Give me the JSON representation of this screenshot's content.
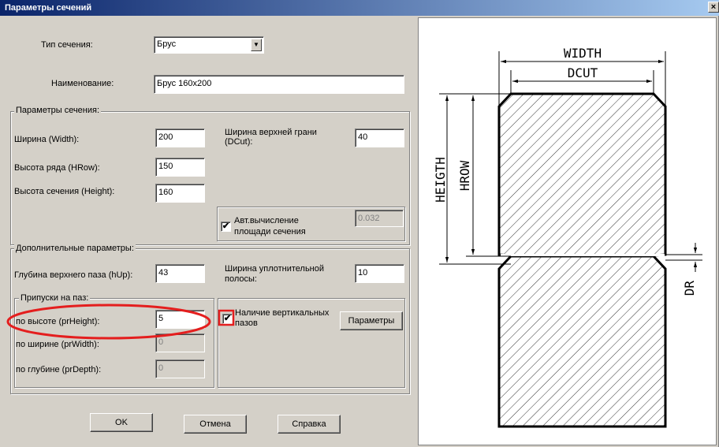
{
  "window": {
    "title": "Параметры сечений",
    "close_label": "×"
  },
  "section_type": {
    "label": "Тип сечения:",
    "value": "Брус"
  },
  "name": {
    "label": "Наименование:",
    "value": "Брус 160x200"
  },
  "section_params": {
    "title": "Параметры сечения:",
    "width_label": "Ширина (Width):",
    "width_value": "200",
    "hrow_label": "Высота ряда (HRow):",
    "hrow_value": "150",
    "height_label": "Высота сечения (Height):",
    "height_value": "160",
    "dcut_label_line1": "Ширина верхней грани",
    "dcut_label_line2": "(DCut):",
    "dcut_value": "40",
    "auto_area_line1": "Авт.вычисление",
    "auto_area_line2": "площади сечения",
    "auto_area_checked": true,
    "area_value": "0.032"
  },
  "extra_params": {
    "title": "Дополнительные параметры:",
    "hup_label": "Глубина верхнего паза (hUp):",
    "hup_value": "43",
    "seal_label_line1": "Ширина уплотнительной",
    "seal_label_line2": "полосы:",
    "seal_value": "10",
    "allowances": {
      "title": "Припуски на паз:",
      "prheight_label": "по высоте (prHeight):",
      "prheight_value": "5",
      "prwidth_label": "по ширине (prWidth):",
      "prwidth_value": "0",
      "prdepth_label": "по глубине (prDepth):",
      "prdepth_value": "0"
    },
    "vertical_grooves_line1": "Наличие вертикальных",
    "vertical_grooves_line2": "пазов",
    "vertical_grooves_checked": true,
    "params_button": "Параметры"
  },
  "buttons": {
    "ok": "OK",
    "cancel": "Отмена",
    "help": "Справка"
  },
  "drawing": {
    "width": "WIDTH",
    "dcut": "DCUT",
    "height": "HEIGTH",
    "hrow": "HROW",
    "dr": "DR"
  },
  "colors": {
    "highlight": "#e41e1e",
    "title_start": "#0a246a",
    "title_end": "#a6caf0"
  }
}
